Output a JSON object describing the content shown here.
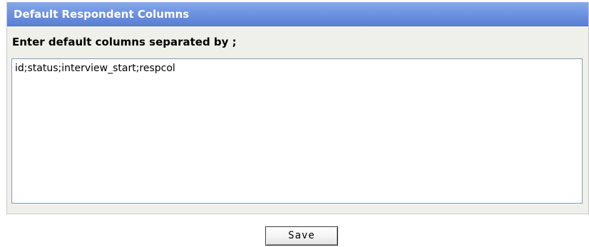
{
  "panel": {
    "title": "Default Respondent Columns",
    "field_label": "Enter default columns separated by ;",
    "columns_value": "id;status;interview_start;respcol"
  },
  "actions": {
    "save_label": "Save"
  },
  "colors": {
    "header_top": "#86a8ea",
    "header_bottom": "#5a7fd5",
    "panel_background": "#f0f0ea",
    "textarea_border": "#7f9db9"
  }
}
